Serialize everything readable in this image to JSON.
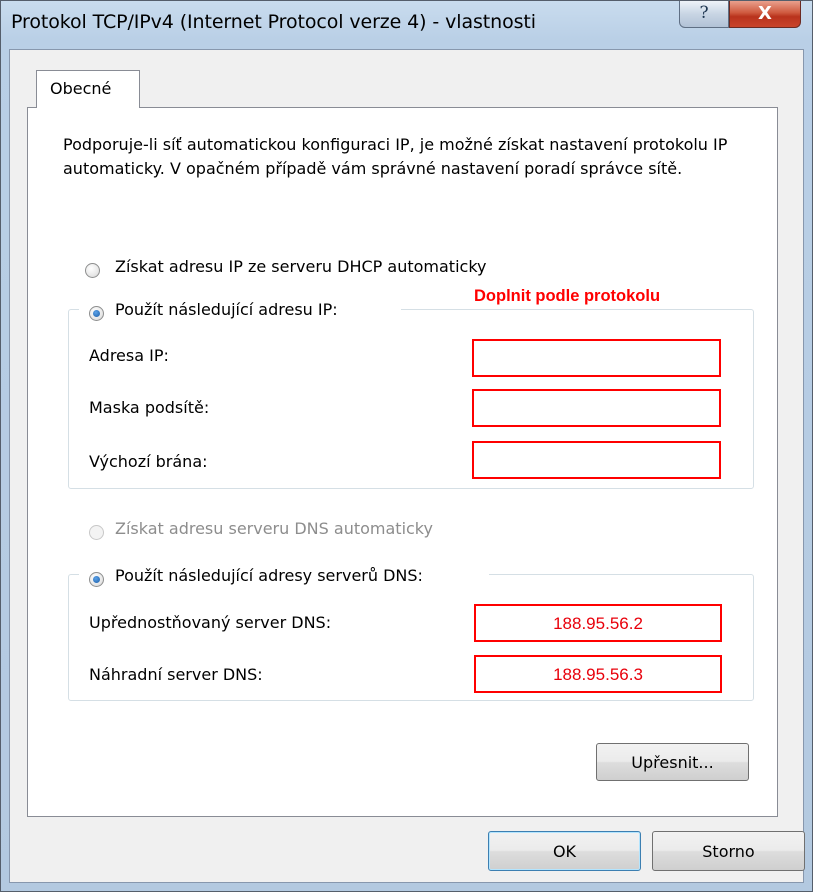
{
  "window": {
    "title": "Protokol TCP/IPv4 (Internet Protocol verze 4) - vlastnosti",
    "help_glyph": "?",
    "close_glyph": "X"
  },
  "tabs": [
    {
      "label": "Obecné",
      "selected": true
    }
  ],
  "description": "Podporuje-li síť automatickou konfiguraci IP, je možné získat nastavení protokolu IP automaticky. V opačném případě vám správné nastavení poradí správce sítě.",
  "ip_section": {
    "auto_option": {
      "label": "Získat adresu IP ze serveru DHCP automaticky",
      "checked": false,
      "enabled": true
    },
    "manual_option": {
      "label": "Použít následující adresu IP:",
      "checked": true,
      "enabled": true
    },
    "fields": [
      {
        "label": "Adresa IP:",
        "value": ""
      },
      {
        "label": "Maska podsítě:",
        "value": ""
      },
      {
        "label": "Výchozí brána:",
        "value": ""
      }
    ]
  },
  "annotation": {
    "text": "Doplnit podle protokolu",
    "color": "#ff0000"
  },
  "dns_section": {
    "auto_option": {
      "label": "Získat adresu serveru DNS automaticky",
      "checked": false,
      "enabled": false
    },
    "manual_option": {
      "label": "Použít následující adresy serverů DNS:",
      "checked": true,
      "enabled": true
    },
    "fields": [
      {
        "label": "Upřednostňovaný server DNS:",
        "value": "188.95.56.2"
      },
      {
        "label": "Náhradní server DNS:",
        "value": "188.95.56.3"
      }
    ]
  },
  "buttons": {
    "advanced": "Upřesnit...",
    "ok": "OK",
    "cancel": "Storno"
  },
  "colors": {
    "highlight_border": "#ff0000",
    "highlight_text": "#e8000b",
    "titlebar": "#b9cfe6",
    "dialog_bg": "#f0f0f0"
  }
}
